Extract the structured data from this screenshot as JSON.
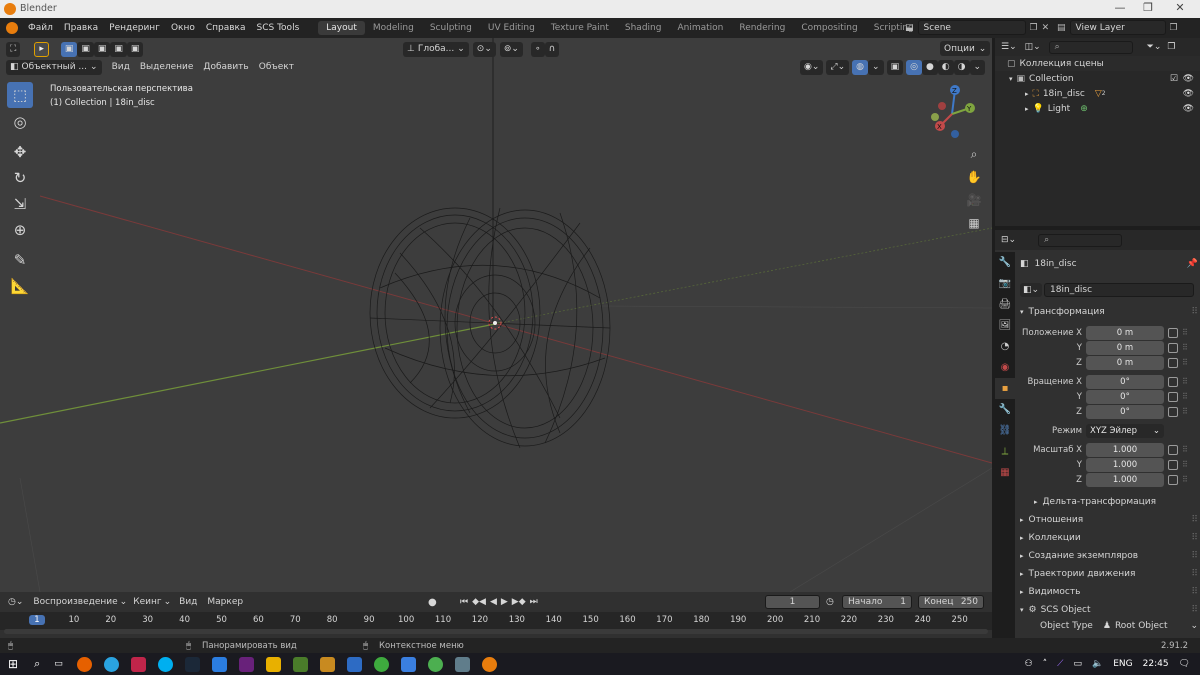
{
  "window": {
    "title": "Blender",
    "min": "—",
    "restore": "❐",
    "close": "✕"
  },
  "menu": {
    "items": [
      "Файл",
      "Правка",
      "Рендеринг",
      "Окно",
      "Справка",
      "SCS Tools"
    ],
    "workspaces": [
      "Layout",
      "Modeling",
      "Sculpting",
      "UV Editing",
      "Texture Paint",
      "Shading",
      "Animation",
      "Rendering",
      "Compositing",
      "Scripting"
    ],
    "add_tab": "+",
    "scene": "Scene",
    "view_layer": "View Layer"
  },
  "viewport": {
    "header": {
      "transform_orientation": "Глоба...",
      "options": "Опции"
    },
    "header2": {
      "mode": "Объектный ...",
      "menus": [
        "Вид",
        "Выделение",
        "Добавить",
        "Объект"
      ]
    },
    "overlay_text": {
      "line1": "Пользовательская перспектива",
      "line2": "(1) Collection | 18in_disc"
    },
    "gizmo": {
      "z": "Z",
      "y": "Y",
      "x": "X"
    }
  },
  "outliner": {
    "rows": [
      {
        "label": "Коллекция сцены"
      },
      {
        "label": "Collection"
      },
      {
        "label": "18in_disc",
        "badge": "2"
      },
      {
        "label": "Light"
      }
    ]
  },
  "properties": {
    "object_name": "18in_disc",
    "datablock": "18in_disc",
    "transform_title": "Трансформация",
    "location": {
      "label": "Положение X",
      "x": "0 m",
      "y": "0 m",
      "z": "0 m"
    },
    "rotation": {
      "label": "Вращение X",
      "x": "0°",
      "y": "0°",
      "z": "0°"
    },
    "mode_label": "Режим",
    "mode_value": "XYZ Эйлер",
    "scale": {
      "label": "Масштаб X",
      "x": "1.000",
      "y": "1.000",
      "z": "1.000"
    },
    "axis_y": "Y",
    "axis_z": "Z",
    "delta": "Дельта-трансформация",
    "sections": [
      "Отношения",
      "Коллекции",
      "Создание экземпляров",
      "Траектории движения",
      "Видимость"
    ],
    "scs_title": "SCS Object",
    "object_type_label": "Object Type",
    "object_type_value": "Root Object"
  },
  "timeline": {
    "menus": [
      "Воспроизведение",
      "Кеинг",
      "Вид",
      "Маркер"
    ],
    "current_frame": "1",
    "start_label": "Начало",
    "start_value": "1",
    "end_label": "Конец",
    "end_value": "250",
    "ticks": [
      "1",
      "10",
      "20",
      "30",
      "40",
      "50",
      "60",
      "70",
      "80",
      "90",
      "100",
      "110",
      "120",
      "130",
      "140",
      "150",
      "160",
      "170",
      "180",
      "190",
      "200",
      "210",
      "220",
      "230",
      "240",
      "250"
    ]
  },
  "status": {
    "pan": "Панорамировать вид",
    "context": "Контекстное меню",
    "version": "2.91.2"
  },
  "taskbar": {
    "lang": "ENG",
    "time": "22:45"
  },
  "colors": {
    "accent": "#4772b3",
    "x_axis": "#c24a4a",
    "y_axis": "#7fa53f",
    "z_axis": "#3f79c9"
  }
}
